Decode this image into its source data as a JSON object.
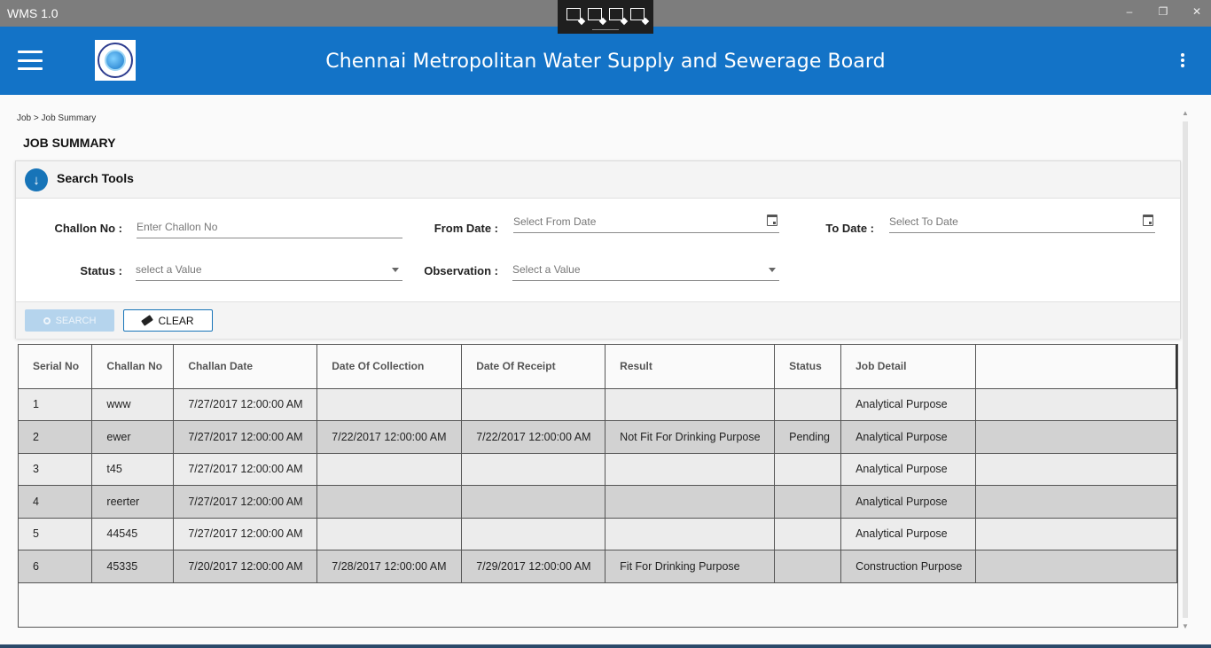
{
  "window": {
    "title": "WMS 1.0",
    "minimize_glyph": "–",
    "restore_glyph": "❐",
    "close_glyph": "✕"
  },
  "header": {
    "title": "Chennai Metropolitan Water Supply and Sewerage Board",
    "background": "#1373c7"
  },
  "breadcrumb": "Job > Job Summary",
  "page_title": "JOB SUMMARY",
  "search_tools": {
    "title": "Search Tools",
    "challan_label": "Challon No :",
    "challan_placeholder": "Enter Challon No",
    "from_date_label": "From Date :",
    "from_date_placeholder": "Select From Date",
    "to_date_label": "To Date :",
    "to_date_placeholder": "Select To Date",
    "status_label": "Status :",
    "status_value": "select a Value",
    "observation_label": "Observation :",
    "observation_value": "Select a Value",
    "search_button": "SEARCH",
    "clear_button": "CLEAR"
  },
  "table": {
    "columns": [
      "Serial No",
      "Challan No",
      "Challan Date",
      "Date Of Collection",
      "Date Of Receipt",
      "Result",
      "Status",
      "Job Detail",
      ""
    ],
    "rows": [
      [
        "1",
        "www",
        "7/27/2017 12:00:00 AM",
        "",
        "",
        "",
        "",
        "Analytical Purpose",
        ""
      ],
      [
        "2",
        "ewer",
        "7/27/2017 12:00:00 AM",
        "7/22/2017 12:00:00 AM",
        "7/22/2017 12:00:00 AM",
        "Not Fit For Drinking Purpose",
        "Pending",
        "Analytical Purpose",
        ""
      ],
      [
        "3",
        "t45",
        "7/27/2017 12:00:00 AM",
        "",
        "",
        "",
        "",
        "Analytical Purpose",
        ""
      ],
      [
        "4",
        "reerter",
        "7/27/2017 12:00:00 AM",
        "",
        "",
        "",
        "",
        "Analytical Purpose",
        ""
      ],
      [
        "5",
        "44545",
        "7/27/2017 12:00:00 AM",
        "",
        "",
        "",
        "",
        "Analytical Purpose",
        ""
      ],
      [
        "6",
        "45335",
        "7/20/2017 12:00:00 AM",
        "7/28/2017 12:00:00 AM",
        "7/29/2017 12:00:00 AM",
        "Fit For Drinking Purpose",
        "",
        "Construction Purpose",
        ""
      ]
    ]
  }
}
